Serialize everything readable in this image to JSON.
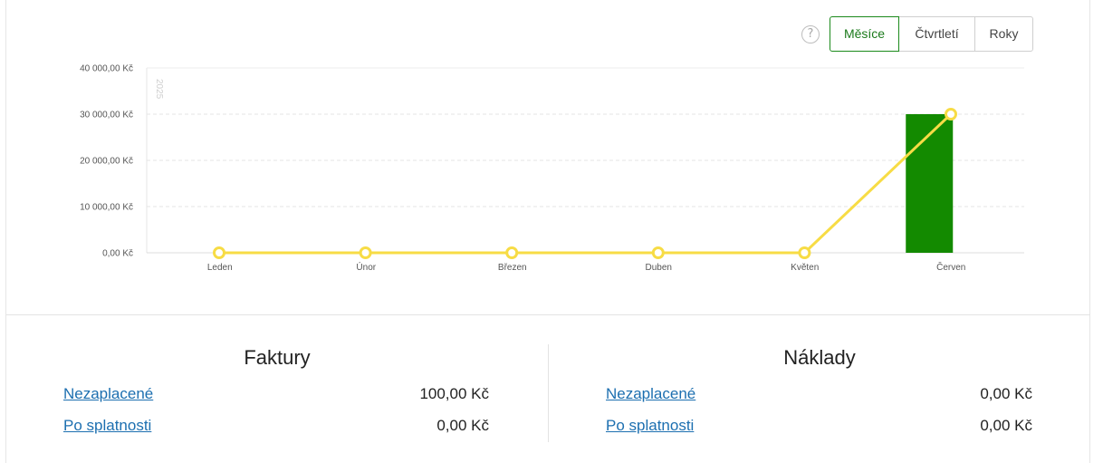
{
  "period_selector": {
    "help_icon": "question-circle-icon",
    "options": [
      "Měsíce",
      "Čtvrtletí",
      "Roky"
    ],
    "selected": "Měsíce"
  },
  "colors": {
    "accent": "#1b8a1b",
    "bar": "#138a00",
    "line": "#f7dc45",
    "link": "#1c6fb0"
  },
  "chart_data": {
    "type": "bar",
    "categories": [
      "Leden",
      "Únor",
      "Březen",
      "Duben",
      "Květen",
      "Červen"
    ],
    "y_tick_labels": [
      "0,00 Kč",
      "10 000,00 Kč",
      "20 000,00 Kč",
      "30 000,00 Kč",
      "40 000,00 Kč"
    ],
    "ylim": [
      0,
      40000
    ],
    "year_label": "2025",
    "grid": true,
    "series": [
      {
        "type": "bar",
        "values": [
          0,
          0,
          0,
          0,
          0,
          30000
        ],
        "color": "#138a00"
      },
      {
        "type": "line",
        "values": [
          0,
          0,
          0,
          0,
          0,
          30000
        ],
        "color": "#f7dc45"
      }
    ]
  },
  "summary": {
    "invoices": {
      "title": "Faktury",
      "rows": [
        {
          "label": "Nezaplacené",
          "amount": "100,00 Kč"
        },
        {
          "label": "Po splatnosti",
          "amount": "0,00 Kč"
        }
      ]
    },
    "costs": {
      "title": "Náklady",
      "rows": [
        {
          "label": "Nezaplacené",
          "amount": "0,00 Kč"
        },
        {
          "label": "Po splatnosti",
          "amount": "0,00 Kč"
        }
      ]
    }
  }
}
